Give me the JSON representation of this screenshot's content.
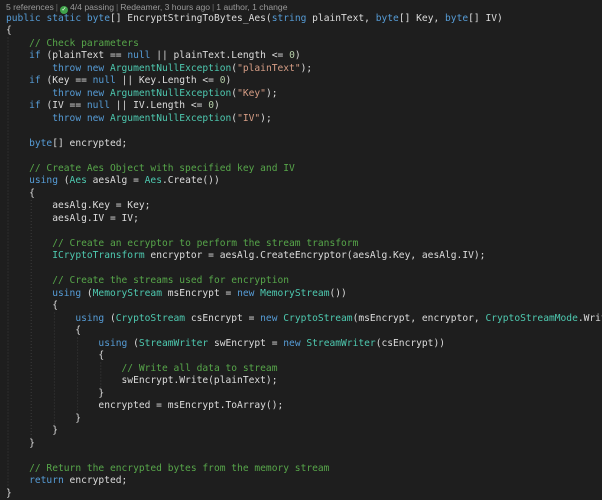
{
  "codelens": {
    "references": "5 references",
    "tests": "4/4 passing",
    "author_time": "Redeamer, 3 hours ago",
    "authors": "1 author, 1 change",
    "separator": "|"
  },
  "colors": {
    "background": "#1e1e1e",
    "keyword": "#569cd6",
    "type": "#4ec9b0",
    "comment": "#57a64a",
    "string": "#d69d85",
    "number": "#b5cea8",
    "plain": "#dcdcdc",
    "pass_badge": "#3fa24a"
  },
  "code": {
    "lines": [
      [
        [
          "kw",
          "public "
        ],
        [
          "kw",
          "static "
        ],
        [
          "kw",
          "byte"
        ],
        [
          "pl",
          "[] EncryptStringToBytes_Aes("
        ],
        [
          "kw",
          "string "
        ],
        [
          "pl",
          "plainText, "
        ],
        [
          "kw",
          "byte"
        ],
        [
          "pl",
          "[] Key, "
        ],
        [
          "kw",
          "byte"
        ],
        [
          "pl",
          "[] IV)"
        ]
      ],
      [
        [
          "pl",
          "{"
        ]
      ],
      [
        [
          "pl",
          "    "
        ],
        [
          "cm",
          "// Check parameters"
        ]
      ],
      [
        [
          "pl",
          "    "
        ],
        [
          "kw",
          "if "
        ],
        [
          "pl",
          "(plainText == "
        ],
        [
          "kw",
          "null "
        ],
        [
          "pl",
          "|| plainText.Length <= "
        ],
        [
          "nm",
          "0"
        ],
        [
          "pl",
          ")"
        ]
      ],
      [
        [
          "pl",
          "        "
        ],
        [
          "kw",
          "throw "
        ],
        [
          "kw",
          "new "
        ],
        [
          "ty",
          "ArgumentNullException"
        ],
        [
          "pl",
          "("
        ],
        [
          "st",
          "\"plainText\""
        ],
        [
          "pl",
          ");"
        ]
      ],
      [
        [
          "pl",
          "    "
        ],
        [
          "kw",
          "if "
        ],
        [
          "pl",
          "(Key == "
        ],
        [
          "kw",
          "null "
        ],
        [
          "pl",
          "|| Key.Length <= "
        ],
        [
          "nm",
          "0"
        ],
        [
          "pl",
          ")"
        ]
      ],
      [
        [
          "pl",
          "        "
        ],
        [
          "kw",
          "throw "
        ],
        [
          "kw",
          "new "
        ],
        [
          "ty",
          "ArgumentNullException"
        ],
        [
          "pl",
          "("
        ],
        [
          "st",
          "\"Key\""
        ],
        [
          "pl",
          ");"
        ]
      ],
      [
        [
          "pl",
          "    "
        ],
        [
          "kw",
          "if "
        ],
        [
          "pl",
          "(IV == "
        ],
        [
          "kw",
          "null "
        ],
        [
          "pl",
          "|| IV.Length <= "
        ],
        [
          "nm",
          "0"
        ],
        [
          "pl",
          ")"
        ]
      ],
      [
        [
          "pl",
          "        "
        ],
        [
          "kw",
          "throw "
        ],
        [
          "kw",
          "new "
        ],
        [
          "ty",
          "ArgumentNullException"
        ],
        [
          "pl",
          "("
        ],
        [
          "st",
          "\"IV\""
        ],
        [
          "pl",
          ");"
        ]
      ],
      [],
      [
        [
          "pl",
          "    "
        ],
        [
          "kw",
          "byte"
        ],
        [
          "pl",
          "[] encrypted;"
        ]
      ],
      [],
      [
        [
          "pl",
          "    "
        ],
        [
          "cm",
          "// Create Aes Object with specified key and IV"
        ]
      ],
      [
        [
          "pl",
          "    "
        ],
        [
          "kw",
          "using "
        ],
        [
          "pl",
          "("
        ],
        [
          "ty",
          "Aes "
        ],
        [
          "pl",
          "aesAlg = "
        ],
        [
          "ty",
          "Aes"
        ],
        [
          "pl",
          ".Create())"
        ]
      ],
      [
        [
          "pl",
          "    {"
        ]
      ],
      [
        [
          "pl",
          "        aesAlg.Key = Key;"
        ]
      ],
      [
        [
          "pl",
          "        aesAlg.IV = IV;"
        ]
      ],
      [],
      [
        [
          "pl",
          "        "
        ],
        [
          "cm",
          "// Create an ecryptor to perform the stream transform"
        ]
      ],
      [
        [
          "pl",
          "        "
        ],
        [
          "ty",
          "ICryptoTransform "
        ],
        [
          "pl",
          "encryptor = aesAlg.CreateEncryptor(aesAlg.Key, aesAlg.IV);"
        ]
      ],
      [],
      [
        [
          "pl",
          "        "
        ],
        [
          "cm",
          "// Create the streams used for encryption"
        ]
      ],
      [
        [
          "pl",
          "        "
        ],
        [
          "kw",
          "using "
        ],
        [
          "pl",
          "("
        ],
        [
          "ty",
          "MemoryStream "
        ],
        [
          "pl",
          "msEncrypt = "
        ],
        [
          "kw",
          "new "
        ],
        [
          "ty",
          "MemoryStream"
        ],
        [
          "pl",
          "())"
        ]
      ],
      [
        [
          "pl",
          "        {"
        ]
      ],
      [
        [
          "pl",
          "            "
        ],
        [
          "kw",
          "using "
        ],
        [
          "pl",
          "("
        ],
        [
          "ty",
          "CryptoStream "
        ],
        [
          "pl",
          "csEncrypt = "
        ],
        [
          "kw",
          "new "
        ],
        [
          "ty",
          "CryptoStream"
        ],
        [
          "pl",
          "(msEncrypt, encryptor, "
        ],
        [
          "ty",
          "CryptoStreamMode"
        ],
        [
          "pl",
          ".Write))"
        ]
      ],
      [
        [
          "pl",
          "            {"
        ]
      ],
      [
        [
          "pl",
          "                "
        ],
        [
          "kw",
          "using "
        ],
        [
          "pl",
          "("
        ],
        [
          "ty",
          "StreamWriter "
        ],
        [
          "pl",
          "swEncrypt = "
        ],
        [
          "kw",
          "new "
        ],
        [
          "ty",
          "StreamWriter"
        ],
        [
          "pl",
          "(csEncrypt))"
        ]
      ],
      [
        [
          "pl",
          "                {"
        ]
      ],
      [
        [
          "pl",
          "                    "
        ],
        [
          "cm",
          "// Write all data to stream"
        ]
      ],
      [
        [
          "pl",
          "                    swEncrypt.Write(plainText);"
        ]
      ],
      [
        [
          "pl",
          "                }"
        ]
      ],
      [
        [
          "pl",
          "                encrypted = msEncrypt.ToArray();"
        ]
      ],
      [
        [
          "pl",
          "            }"
        ]
      ],
      [
        [
          "pl",
          "        }"
        ]
      ],
      [
        [
          "pl",
          "    }"
        ]
      ],
      [],
      [
        [
          "pl",
          "    "
        ],
        [
          "cm",
          "// Return the encrypted bytes from the memory stream"
        ]
      ],
      [
        [
          "pl",
          "    "
        ],
        [
          "kw",
          "return "
        ],
        [
          "pl",
          "encrypted;"
        ]
      ],
      [
        [
          "pl",
          "}"
        ]
      ]
    ]
  }
}
